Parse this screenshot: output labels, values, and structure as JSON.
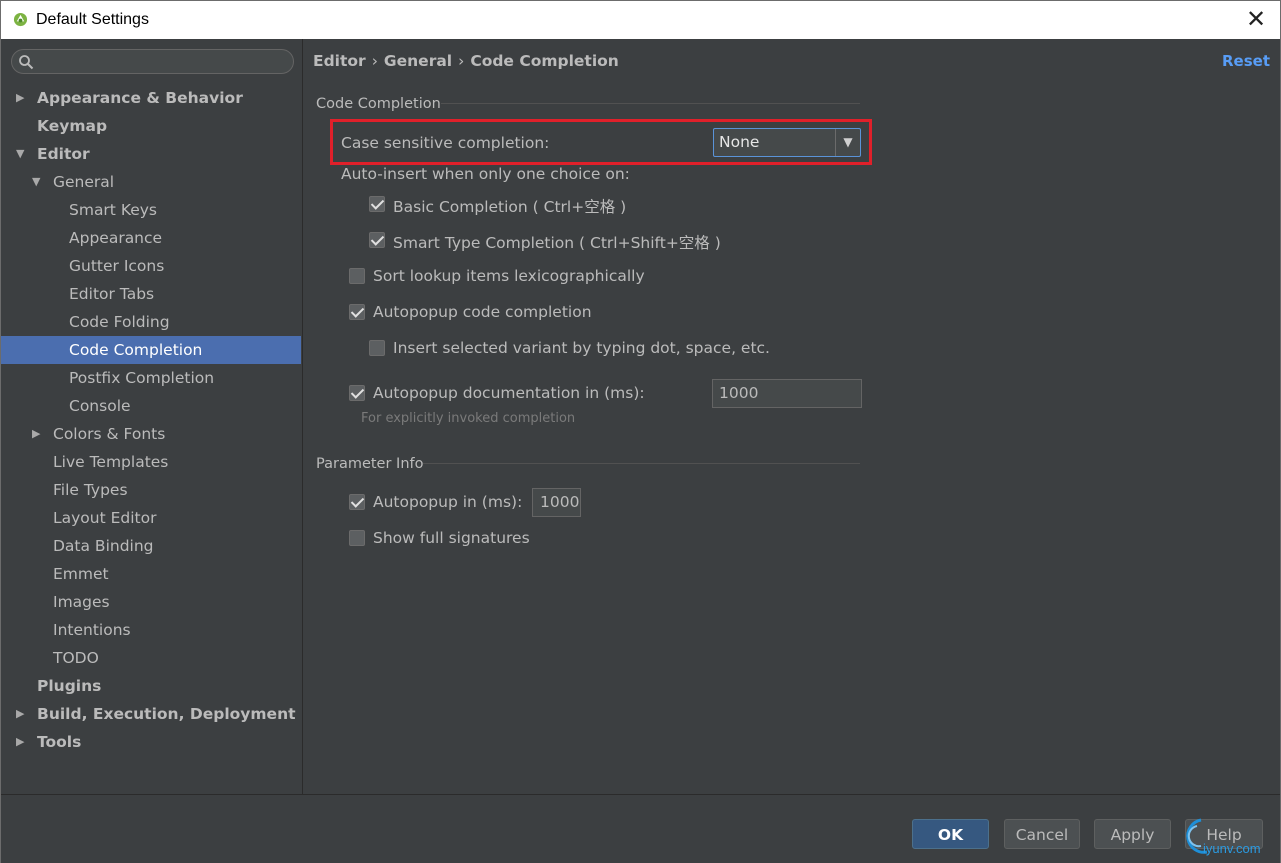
{
  "window": {
    "title": "Default Settings",
    "close_glyph": "✕"
  },
  "sidebar": {
    "search_icon": "search-icon",
    "items": [
      {
        "label": "Appearance & Behavior",
        "arrow": "▶"
      },
      {
        "label": "Keymap"
      },
      {
        "label": "Editor",
        "arrow": "▼"
      },
      {
        "label": "General",
        "arrow": "▼"
      },
      {
        "label": "Smart Keys"
      },
      {
        "label": "Appearance"
      },
      {
        "label": "Gutter Icons"
      },
      {
        "label": "Editor Tabs"
      },
      {
        "label": "Code Folding"
      },
      {
        "label": "Code Completion"
      },
      {
        "label": "Postfix Completion"
      },
      {
        "label": "Console"
      },
      {
        "label": "Colors & Fonts",
        "arrow": "▶"
      },
      {
        "label": "Live Templates"
      },
      {
        "label": "File Types"
      },
      {
        "label": "Layout Editor"
      },
      {
        "label": "Data Binding"
      },
      {
        "label": "Emmet"
      },
      {
        "label": "Images"
      },
      {
        "label": "Intentions"
      },
      {
        "label": "TODO"
      },
      {
        "label": "Plugins"
      },
      {
        "label": "Build, Execution, Deployment",
        "arrow": "▶"
      },
      {
        "label": "Tools",
        "arrow": "▶"
      }
    ]
  },
  "header": {
    "breadcrumb": [
      "Editor",
      "General",
      "Code Completion"
    ],
    "separator": "›",
    "reset_label": "Reset"
  },
  "code_completion": {
    "section_title": "Code Completion",
    "case_sensitive_label": "Case sensitive completion:",
    "case_sensitive_value": "None",
    "dropdown_glyph": "▼",
    "auto_insert_label": "Auto-insert when only one choice on:",
    "basic_completion_label": "Basic Completion ( Ctrl+空格 )",
    "basic_completion_checked": true,
    "smart_type_label": "Smart Type Completion ( Ctrl+Shift+空格 )",
    "smart_type_checked": true,
    "sort_lookup_label": "Sort lookup items lexicographically",
    "sort_lookup_checked": false,
    "autopopup_code_label": "Autopopup code completion",
    "autopopup_code_checked": true,
    "insert_variant_label": "Insert selected variant by typing dot, space, etc.",
    "insert_variant_checked": false,
    "autopopup_doc_label": "Autopopup documentation in (ms):",
    "autopopup_doc_checked": true,
    "autopopup_doc_value": "1000",
    "autopopup_doc_hint": "For explicitly invoked completion"
  },
  "parameter_info": {
    "section_title": "Parameter Info",
    "autopopup_label": "Autopopup in (ms):",
    "autopopup_checked": true,
    "autopopup_value": "1000",
    "full_signatures_label": "Show full signatures",
    "full_signatures_checked": false
  },
  "footer": {
    "ok_label": "OK",
    "cancel_label": "Cancel",
    "apply_label": "Apply",
    "help_label": "Help"
  },
  "watermark": {
    "text": "iyunv.com"
  },
  "colors": {
    "background": "#3c3f41",
    "selection": "#4b6eaf",
    "accent_link": "#589df6",
    "highlight_box": "#e0202a",
    "primary_button": "#365880"
  }
}
